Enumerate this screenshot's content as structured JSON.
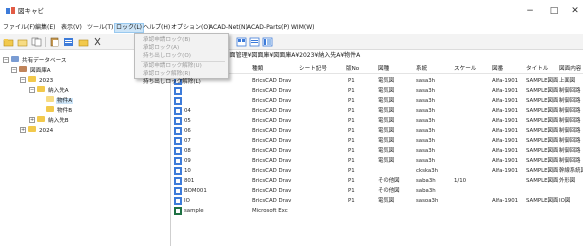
{
  "window": {
    "title": "図キャビ",
    "minimize": "−",
    "maximize": "□",
    "close": "✕"
  },
  "menu": [
    "ファイル(F)",
    "編集(E)",
    "表示(V)",
    "ツール(T)",
    "ロック(L)",
    "ヘルプ(H)",
    "オプション(O)",
    "ACAD-Net(N)",
    "ACAD-Parts(P)",
    "WIM(W)"
  ],
  "lock_menu": {
    "items": [
      {
        "label": "承認申請ロック(B)",
        "enabled": false
      },
      {
        "label": "承認ロック(A)",
        "enabled": false
      },
      {
        "label": "持ち出しロック(O)",
        "enabled": false
      },
      {
        "label": "承認申請ロック解除(U)",
        "enabled": false
      },
      {
        "label": "承認ロック解除(R)",
        "enabled": false
      },
      {
        "label": "持ち出しロック解除(L)",
        "enabled": true
      }
    ]
  },
  "path": "amoto¥Desktop¥図面管理¥図面庫¥図面庫A¥2023¥納入先A¥物件A",
  "tree": [
    {
      "label": "共有データベース",
      "expander": "−",
      "icon": "database"
    },
    {
      "label": "図面庫A",
      "expander": "−",
      "icon": "cabinet"
    },
    {
      "label": "2023",
      "expander": "−",
      "icon": "folder"
    },
    {
      "label": "納入先A",
      "expander": "−",
      "icon": "folder"
    },
    {
      "label": "物件A",
      "expander": "",
      "icon": "folder",
      "selected": true
    },
    {
      "label": "物件B",
      "expander": "",
      "icon": "folder"
    },
    {
      "label": "納入先B",
      "expander": "+",
      "icon": "folder"
    },
    {
      "label": "2024",
      "expander": "+",
      "icon": "folder"
    }
  ],
  "columns": [
    "種類",
    "シート記号",
    "版No",
    "図種",
    "系統",
    "スケール",
    "図番",
    "タイトル",
    "図面内容"
  ],
  "rows": [
    {
      "name": "",
      "type": "BricsCAD Drav",
      "sheet": "",
      "rev": "P1",
      "kind": "電気図",
      "system": "sasa3h",
      "scale": "",
      "dwg": "Alfa-1901",
      "title": "SAMPLE図面",
      "content": "上面図"
    },
    {
      "name": "",
      "type": "BricsCAD Drav",
      "sheet": "",
      "rev": "P1",
      "kind": "電気図",
      "system": "sasa3h",
      "scale": "",
      "dwg": "Alfa-1901",
      "title": "SAMPLE図面",
      "content": "制御回路"
    },
    {
      "name": "",
      "type": "BricsCAD Drav",
      "sheet": "",
      "rev": "P1",
      "kind": "電気図",
      "system": "sasa3h",
      "scale": "",
      "dwg": "Alfa-1901",
      "title": "SAMPLE図面",
      "content": "制御回路"
    },
    {
      "name": "04",
      "type": "BricsCAD Drav",
      "sheet": "",
      "rev": "P1",
      "kind": "電気図",
      "system": "sasa3h",
      "scale": "",
      "dwg": "Alfa-1901",
      "title": "SAMPLE図面",
      "content": "制御回路"
    },
    {
      "name": "05",
      "type": "BricsCAD Drav",
      "sheet": "",
      "rev": "P1",
      "kind": "電気図",
      "system": "sasa3h",
      "scale": "",
      "dwg": "Alfa-1901",
      "title": "SAMPLE図面",
      "content": "制御回路"
    },
    {
      "name": "06",
      "type": "BricsCAD Drav",
      "sheet": "",
      "rev": "P1",
      "kind": "電気図",
      "system": "sasa3h",
      "scale": "",
      "dwg": "Alfa-1901",
      "title": "SAMPLE図面",
      "content": "制御回路"
    },
    {
      "name": "07",
      "type": "BricsCAD Drav",
      "sheet": "",
      "rev": "P1",
      "kind": "電気図",
      "system": "sasa3h",
      "scale": "",
      "dwg": "Alfa-1901",
      "title": "SAMPLE図面",
      "content": "制御回路"
    },
    {
      "name": "08",
      "type": "BricsCAD Drav",
      "sheet": "",
      "rev": "P1",
      "kind": "電気図",
      "system": "sasa3h",
      "scale": "",
      "dwg": "Alfa-1901",
      "title": "SAMPLE図面",
      "content": "制御回路"
    },
    {
      "name": "09",
      "type": "BricsCAD Drav",
      "sheet": "",
      "rev": "P1",
      "kind": "電気図",
      "system": "sasa3h",
      "scale": "",
      "dwg": "Alfa-1901",
      "title": "SAMPLE図面",
      "content": "制御回路"
    },
    {
      "name": "10",
      "type": "BricsCAD Drav",
      "sheet": "",
      "rev": "P1",
      "kind": "",
      "system": "ckska3h",
      "scale": "",
      "dwg": "Alfa-1901",
      "title": "SAMPLE図面",
      "content": "幹線系統図"
    },
    {
      "name": "801",
      "type": "BricsCAD Drav",
      "sheet": "",
      "rev": "P1",
      "kind": "その他図",
      "system": "saba3h",
      "scale": "1/10",
      "dwg": "",
      "title": "SAMPLE図面",
      "content": "外形図"
    },
    {
      "name": "BOM001",
      "type": "BricsCAD Drav",
      "sheet": "",
      "rev": "P1",
      "kind": "その他図",
      "system": "saba3h",
      "scale": "",
      "dwg": "",
      "title": "",
      "content": ""
    },
    {
      "name": "IO",
      "type": "BricsCAD Drav",
      "sheet": "",
      "rev": "P1",
      "kind": "電気図",
      "system": "sasoa3h",
      "scale": "",
      "dwg": "Alfa-1901",
      "title": "SAMPLE図面",
      "content": "IO図"
    },
    {
      "name": "sample",
      "type": "Microsoft Exc",
      "sheet": "",
      "rev": "",
      "kind": "",
      "system": "",
      "scale": "",
      "dwg": "",
      "title": "",
      "content": ""
    }
  ],
  "icons": {
    "app": "cabinet-icon",
    "toolbar": [
      "new-folder-icon",
      "open-icon",
      "copy-icon",
      "paste-icon",
      "properties-icon",
      "folder-icon",
      "cut-icon",
      "view-large-icon",
      "view-list-icon",
      "view-detail-icon",
      "refresh-icon"
    ]
  },
  "colors": {
    "selection": "#cce4f7",
    "folder": "#f2c94c",
    "cad_icon": "#3d7bd9",
    "excel_icon": "#1f7244",
    "disabled_text": "#9b9b9b"
  }
}
